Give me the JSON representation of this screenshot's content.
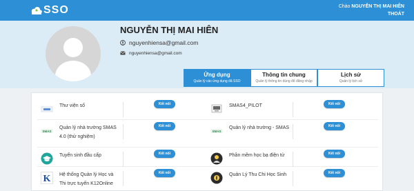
{
  "header": {
    "logo_text": "SSO",
    "greeting_prefix": "Chào",
    "user_name": "NGUYỄN THỊ MAI HIÊN",
    "logout_label": "THOÁT"
  },
  "profile": {
    "name": "NGUYỄN THỊ MAI HIÊN",
    "username": "nguyenhiensa@gmail.com",
    "email": "nguyenhiensa@gmail.com"
  },
  "tabs": [
    {
      "title": "Ứng dụng",
      "subtitle": "Quản lý các ứng dụng đã SSO",
      "active": true
    },
    {
      "title": "Thông tin chung",
      "subtitle": "Quản lý thông tin dùng để đăng nhập",
      "active": false
    },
    {
      "title": "Lịch sử",
      "subtitle": "Quản lý lịch sử",
      "active": false
    }
  ],
  "connect_label": "Kết nối",
  "apps": [
    {
      "name": "Thư viện số",
      "icon": "digital-library-icon"
    },
    {
      "name": "SMAS4_PILOT",
      "icon": "smas4-pilot-icon"
    },
    {
      "name": "Quản lý nhà trường SMAS 4.0 (thử nghiệm)",
      "icon": "smas-icon"
    },
    {
      "name": "Quản lý nhà trường - SMAS",
      "icon": "smas-icon"
    },
    {
      "name": "Tuyển sinh đầu cấp",
      "icon": "graduation-cap-icon"
    },
    {
      "name": "Phần mềm học bạ điện tử",
      "icon": "e-record-icon"
    },
    {
      "name": "Hệ thống Quản lý Học và Thi trực tuyến K12Online",
      "icon": "k12online-icon"
    },
    {
      "name": "Quản Lý Thu Chi Học Sinh",
      "icon": "finance-icon"
    }
  ],
  "colors": {
    "primary": "#2d8fd5",
    "profile_bg": "#dcecf6",
    "page_bg": "#edf1f4"
  }
}
